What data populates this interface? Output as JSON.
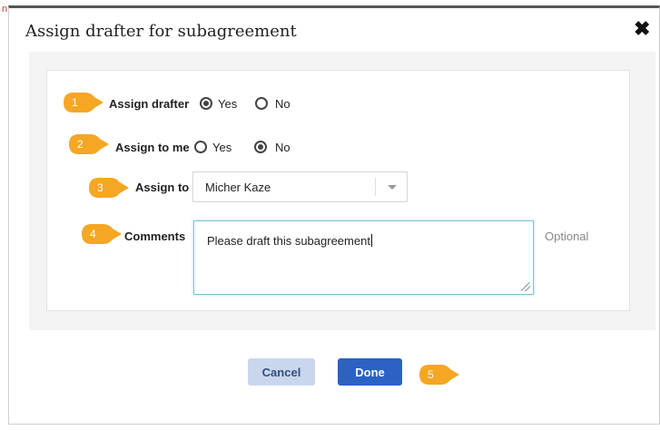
{
  "dialog": {
    "title": "Assign drafter for subagreement",
    "close_icon": "close-icon"
  },
  "form": {
    "assign_drafter": {
      "label": "Assign drafter",
      "options": [
        "Yes",
        "No"
      ],
      "selected": "Yes"
    },
    "assign_to_me": {
      "label": "Assign to me",
      "options": [
        "Yes",
        "No"
      ],
      "selected": "No"
    },
    "assign_to": {
      "label": "Assign to",
      "value": "Micher Kaze"
    },
    "comments": {
      "label": "Comments",
      "value": "Please draft this subagreement",
      "hint": "Optional"
    }
  },
  "actions": {
    "cancel_label": "Cancel",
    "done_label": "Done"
  },
  "callouts": [
    "1",
    "2",
    "3",
    "4",
    "5"
  ],
  "colors": {
    "callout": "#f5a623",
    "primary": "#2b62c4",
    "secondary": "#c9d6ee"
  }
}
